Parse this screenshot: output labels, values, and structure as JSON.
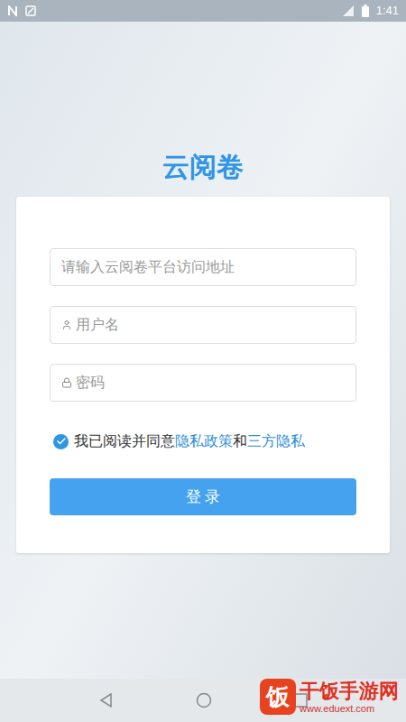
{
  "status_bar": {
    "time": "1:41"
  },
  "title": "云阅卷",
  "fields": [
    {
      "placeholder": "请输入云阅卷平台访问地址",
      "kind": "url"
    },
    {
      "placeholder": "用户名",
      "kind": "user"
    },
    {
      "placeholder": "密码",
      "kind": "password"
    }
  ],
  "agreement": {
    "checked": true,
    "segments": [
      {
        "text": "我已阅读并同意",
        "kind": "text"
      },
      {
        "text": "隐私政策",
        "kind": "link"
      },
      {
        "text": "和",
        "kind": "text"
      },
      {
        "text": "三方隐私",
        "kind": "link"
      }
    ]
  },
  "login_button": "登 录",
  "watermark": {
    "logo": "饭",
    "name": "干饭手游网",
    "url": "www.eduext.com"
  }
}
